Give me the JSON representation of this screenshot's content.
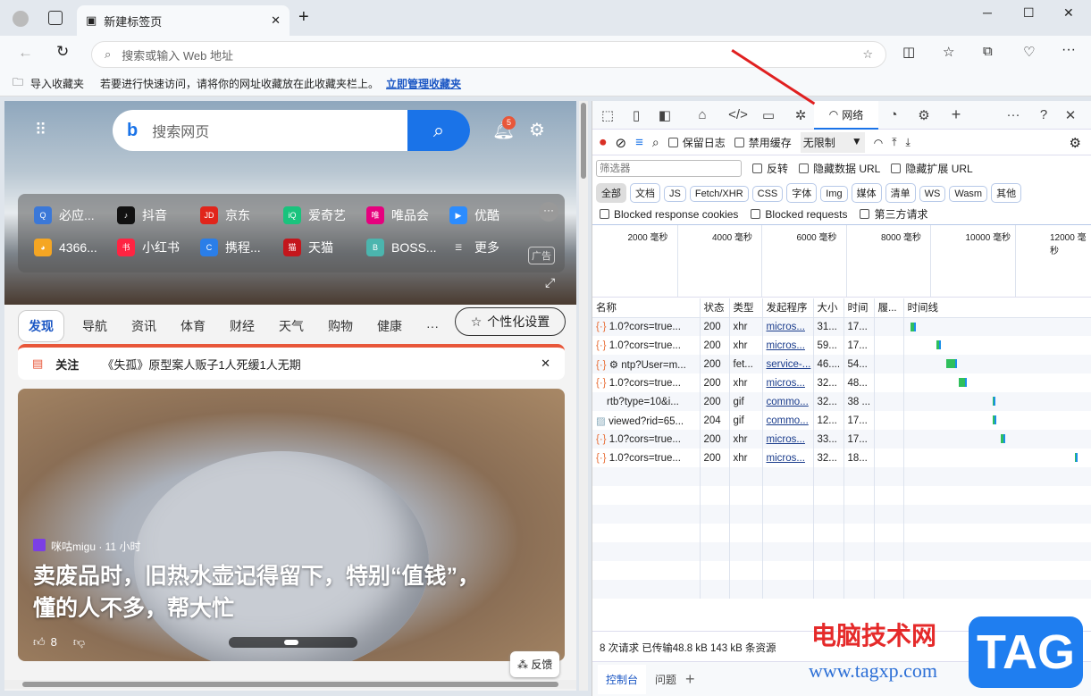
{
  "browser": {
    "tab_title": "新建标签页",
    "new_tab": "+",
    "address_placeholder": "搜索或输入 Web 地址",
    "favorites": {
      "import": "导入收藏夹",
      "hint": "若要进行快速访问，请将你的网址收藏放在此收藏夹栏上。",
      "manage_link": "立即管理收藏夹"
    }
  },
  "page": {
    "search_placeholder": "搜索网页",
    "notification_count": "5",
    "quick_links": [
      {
        "label": "必应...",
        "color": "#3b78d8",
        "glyph": "Q"
      },
      {
        "label": "抖音",
        "color": "#111111",
        "glyph": "♪"
      },
      {
        "label": "京东",
        "color": "#e1251b",
        "glyph": "JD"
      },
      {
        "label": "爱奇艺",
        "color": "#19c37d",
        "glyph": "iQ"
      },
      {
        "label": "唯品会",
        "color": "#e6007e",
        "glyph": "唯"
      },
      {
        "label": "优酷",
        "color": "#2b8cff",
        "glyph": "▶"
      },
      {
        "label": "4366...",
        "color": "#f5a623",
        "glyph": "◕"
      },
      {
        "label": "小红书",
        "color": "#ff2442",
        "glyph": "书"
      },
      {
        "label": "携程...",
        "color": "#2a7ee8",
        "glyph": "C"
      },
      {
        "label": "天猫",
        "color": "#c4161c",
        "glyph": "猫"
      },
      {
        "label": "BOSS...",
        "color": "#4bb5ae",
        "glyph": "B"
      },
      {
        "label": "更多",
        "color": "transparent",
        "glyph": "☰"
      }
    ],
    "ad_label": "广告",
    "nav": [
      "发现",
      "导航",
      "资讯",
      "体育",
      "财经",
      "天气",
      "购物",
      "健康",
      "···"
    ],
    "personalize": "个性化设置",
    "notice": {
      "tag": "关注",
      "text": "《失孤》原型案人贩子1人死缓1人无期"
    },
    "card": {
      "source": "咪咕migu · 11 小时",
      "title_line1": "卖废品时，旧热水壶记得留下，特别“值钱”，",
      "title_line2": "懂的人不多，帮大忙",
      "likes": "8"
    },
    "feedback": "反馈"
  },
  "devtools": {
    "active_tab": "网络",
    "throttle": "无限制",
    "preserve_log": "保留日志",
    "disable_cache": "禁用缓存",
    "filter_placeholder": "筛选器",
    "invert": "反转",
    "hide_data_url": "隐藏数据 URL",
    "hide_ext_url": "隐藏扩展 URL",
    "types": [
      "全部",
      "文档",
      "JS",
      "Fetch/XHR",
      "CSS",
      "字体",
      "Img",
      "媒体",
      "清单",
      "WS",
      "Wasm",
      "其他"
    ],
    "blocked_cookies": "Blocked response cookies",
    "blocked_requests": "Blocked requests",
    "third_party": "第三方请求",
    "overview_ticks": [
      "2000 毫秒",
      "4000 毫秒",
      "6000 毫秒",
      "8000 毫秒",
      "10000 毫秒",
      "12000 毫秒"
    ],
    "columns": [
      "名称",
      "状态",
      "类型",
      "发起程序",
      "大小",
      "时间",
      "履...",
      "时间线"
    ],
    "requests": [
      {
        "name": "1.0?cors=true...",
        "status": "200",
        "type": "xhr",
        "initiator": "micros...",
        "size": "31...",
        "time": "17...",
        "start": 0.02,
        "dur": 0.03
      },
      {
        "name": "1.0?cors=true...",
        "status": "200",
        "type": "xhr",
        "initiator": "micros...",
        "size": "59...",
        "time": "17...",
        "start": 0.17,
        "dur": 0.03
      },
      {
        "name": "⚙ ntp?User=m...",
        "status": "200",
        "type": "fet...",
        "initiator": "service-...",
        "size": "46....",
        "time": "54...",
        "start": 0.23,
        "dur": 0.06
      },
      {
        "name": "1.0?cors=true...",
        "status": "200",
        "type": "xhr",
        "initiator": "micros...",
        "size": "32...",
        "time": "48...",
        "start": 0.3,
        "dur": 0.05
      },
      {
        "name": "rtb?type=10&i...",
        "status": "200",
        "type": "gif",
        "initiator": "commo...",
        "size": "32...",
        "time": "38 ...",
        "start": 0.5,
        "dur": 0.02
      },
      {
        "name": "viewed?rid=65...",
        "status": "204",
        "type": "gif",
        "initiator": "commo...",
        "size": "12...",
        "time": "17...",
        "start": 0.5,
        "dur": 0.025
      },
      {
        "name": "1.0?cors=true...",
        "status": "200",
        "type": "xhr",
        "initiator": "micros...",
        "size": "33...",
        "time": "17...",
        "start": 0.55,
        "dur": 0.025
      },
      {
        "name": "1.0?cors=true...",
        "status": "200",
        "type": "xhr",
        "initiator": "micros...",
        "size": "32...",
        "time": "18...",
        "start": 0.985,
        "dur": 0.01
      }
    ],
    "summary": "8 次请求  已传输48.8 kB  143 kB 条资源",
    "drawer_tabs": [
      "控制台",
      "问题"
    ]
  },
  "watermark": {
    "title": "电脑技术网",
    "url": "www.tagxp.com",
    "logo": "TAG"
  }
}
